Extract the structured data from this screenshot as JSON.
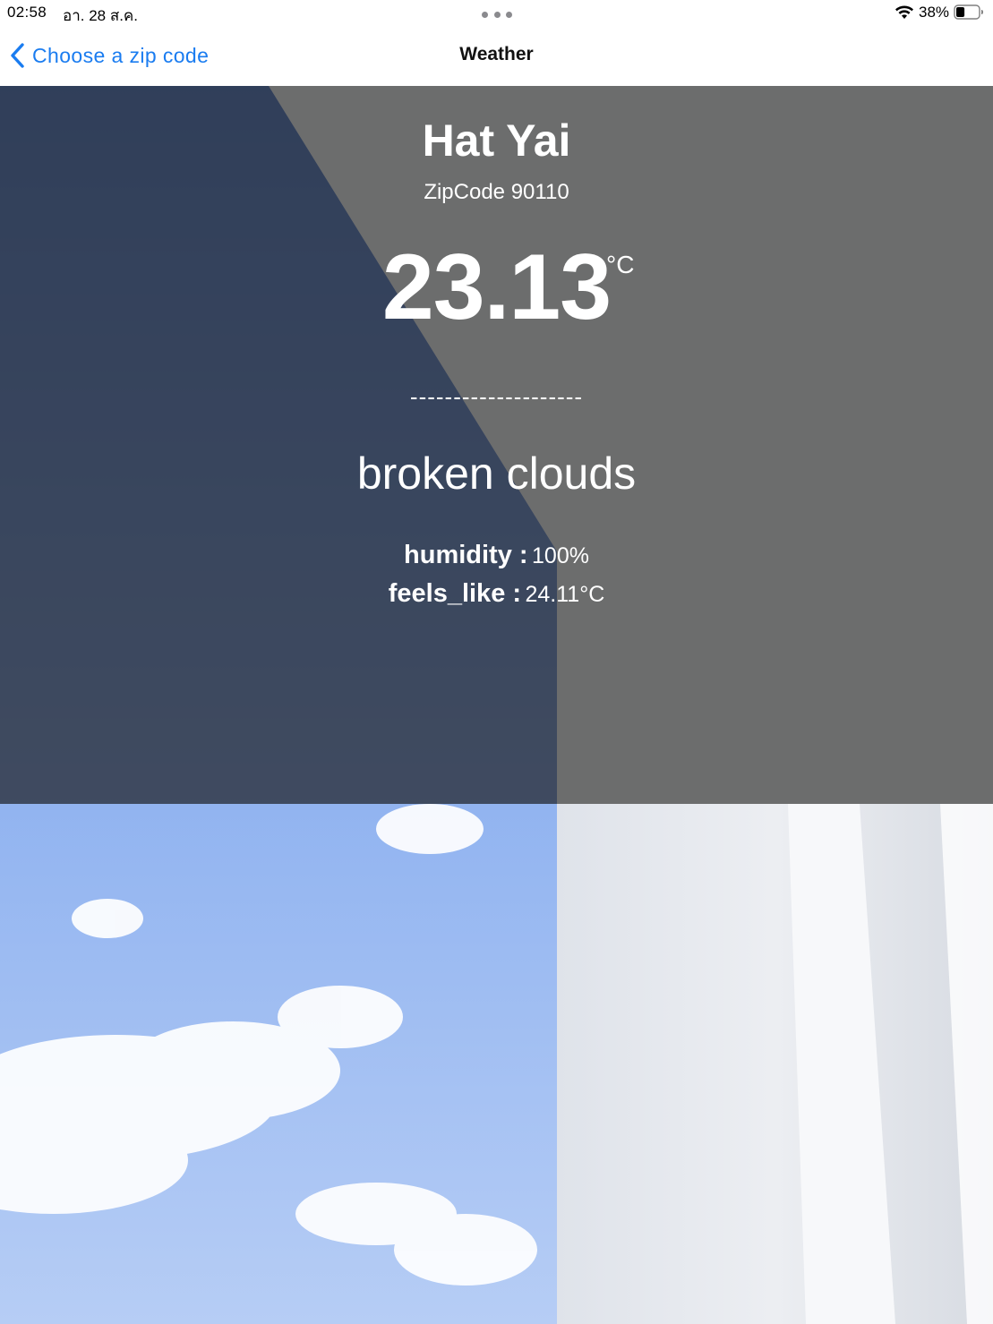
{
  "status_bar": {
    "time": "02:58",
    "date": "อา. 28 ส.ค.",
    "battery_percent": "38%",
    "battery_level": 0.38,
    "icons": [
      "wifi-icon",
      "battery-icon"
    ]
  },
  "nav": {
    "back_label": "Choose a zip code",
    "title": "Weather",
    "accent_color": "#1a7cf0"
  },
  "weather": {
    "city": "Hat Yai",
    "zipcode_label": "ZipCode",
    "zipcode": "90110",
    "temperature": "23.13",
    "unit": "°C",
    "divider": "--------------------",
    "description": "broken clouds",
    "details": [
      {
        "label": "humidity :",
        "value": "100%"
      },
      {
        "label": "feels_like :",
        "value": "24.11°C"
      }
    ]
  }
}
